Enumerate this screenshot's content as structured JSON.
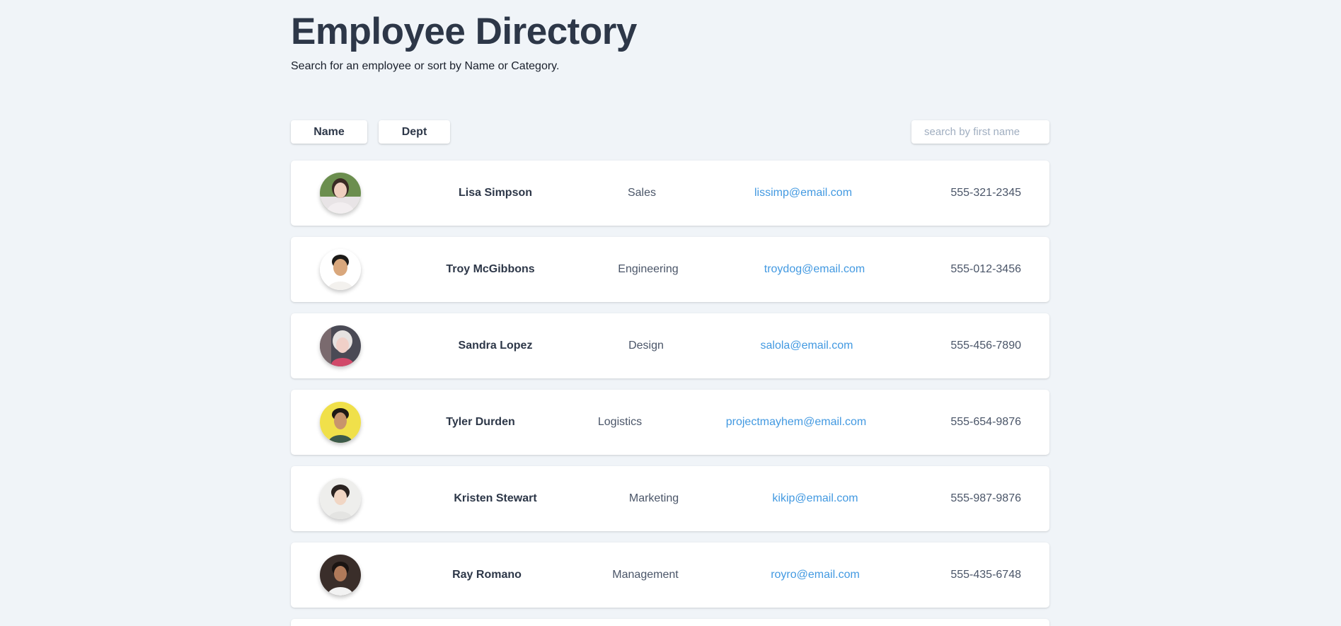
{
  "header": {
    "title": "Employee Directory",
    "subtitle": "Search for an employee or sort by Name or Category."
  },
  "controls": {
    "sort_name_label": "Name",
    "sort_dept_label": "Dept",
    "search_placeholder": "search by first name",
    "search_value": ""
  },
  "employees": [
    {
      "name": "Lisa Simpson",
      "dept": "Sales",
      "email": "lissimp@email.com",
      "phone": "555-321-2345",
      "avatar": "avatar-photo"
    },
    {
      "name": "Troy McGibbons",
      "dept": "Engineering",
      "email": "troydog@email.com",
      "phone": "555-012-3456",
      "avatar": "avatar-photo"
    },
    {
      "name": "Sandra Lopez",
      "dept": "Design",
      "email": "salola@email.com",
      "phone": "555-456-7890",
      "avatar": "avatar-photo"
    },
    {
      "name": "Tyler Durden",
      "dept": "Logistics",
      "email": "projectmayhem@email.com",
      "phone": "555-654-9876",
      "avatar": "avatar-photo"
    },
    {
      "name": "Kristen Stewart",
      "dept": "Marketing",
      "email": "kikip@email.com",
      "phone": "555-987-9876",
      "avatar": "avatar-photo"
    },
    {
      "name": "Ray Romano",
      "dept": "Management",
      "email": "royro@email.com",
      "phone": "555-435-6748",
      "avatar": "avatar-photo"
    }
  ],
  "colors": {
    "background": "#f0f4f8",
    "card": "#ffffff",
    "heading": "#2d3748",
    "link": "#4299e1",
    "muted": "#4a5568"
  }
}
